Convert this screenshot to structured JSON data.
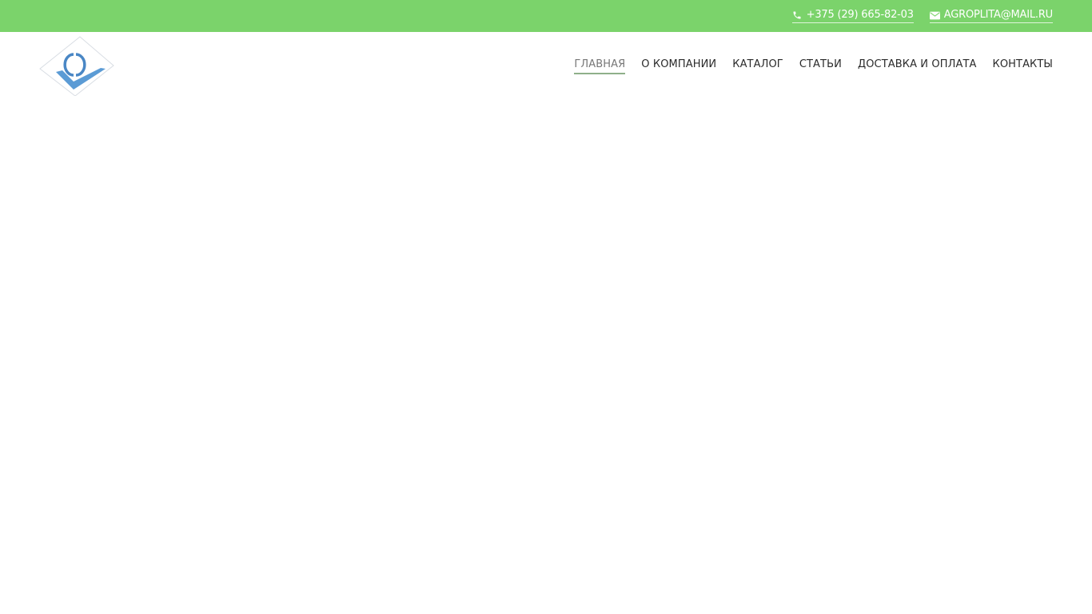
{
  "colors": {
    "topbar_bg": "#7bd36b",
    "nav_text": "#2a2a2a",
    "nav_active_text": "#777777",
    "nav_active_underline": "#8fb08a",
    "logo_blue": "#5b9bd5"
  },
  "topbar": {
    "phone": {
      "icon": "phone-icon",
      "label": "+375 (29) 665-82-03"
    },
    "email": {
      "icon": "envelope-icon",
      "label": "AGROPLITA@MAIL.RU"
    }
  },
  "logo": {
    "icon": "checkmark-diamond-logo"
  },
  "nav": {
    "items": [
      {
        "label": "ГЛАВНАЯ",
        "active": true
      },
      {
        "label": "О КОМПАНИИ",
        "active": false
      },
      {
        "label": "КАТАЛОГ",
        "active": false
      },
      {
        "label": "СТАТЬИ",
        "active": false
      },
      {
        "label": "ДОСТАВКА И ОПЛАТА",
        "active": false
      },
      {
        "label": "КОНТАКТЫ",
        "active": false
      }
    ]
  }
}
